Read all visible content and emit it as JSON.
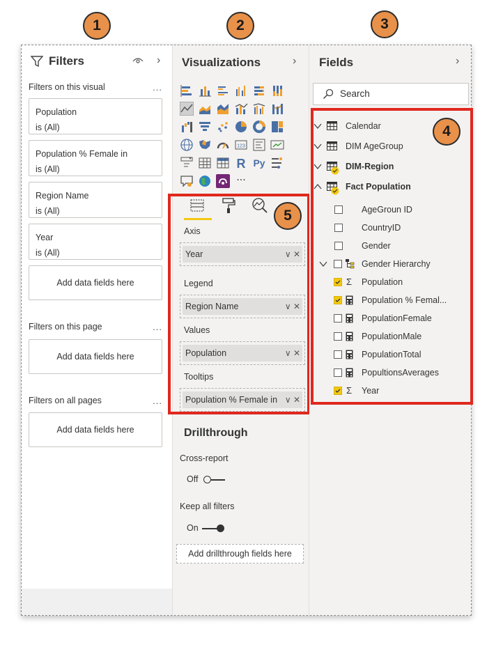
{
  "callouts": [
    "1",
    "2",
    "3",
    "4",
    "5"
  ],
  "filters": {
    "title": "Filters",
    "visual_section": "Filters on this visual",
    "cards": [
      {
        "name": "Population",
        "value": "is (All)"
      },
      {
        "name": "Population % Female in",
        "value": "is (All)"
      },
      {
        "name": "Region Name",
        "value": "is (All)"
      },
      {
        "name": "Year",
        "value": "is (All)"
      }
    ],
    "add_label": "Add data fields here",
    "page_section": "Filters on this page",
    "all_section": "Filters on all pages",
    "more": "...",
    "chevron": "›"
  },
  "viz": {
    "title": "Visualizations",
    "chevron": "›",
    "icon_rows": [
      [
        "stacked-bar-icon",
        "stacked-column-icon",
        "clustered-bar-icon",
        "clustered-column-icon",
        "100-bar-icon",
        "100-column-icon"
      ],
      [
        "line-chart-icon",
        "area-chart-icon",
        "stacked-area-icon",
        "line-column-icon",
        "line-clustered-icon",
        "ribbon-chart-icon"
      ],
      [
        "waterfall-icon",
        "funnel-icon",
        "scatter-icon",
        "pie-icon",
        "donut-icon",
        "treemap-icon"
      ],
      [
        "map-icon",
        "filled-map-icon",
        "gauge-icon",
        "card-icon",
        "multirow-card-icon",
        "kpi-icon"
      ],
      [
        "slicer-icon",
        "table-icon",
        "matrix-icon",
        "r-visual-icon",
        "python-visual-icon",
        "key-influencers-icon"
      ],
      [
        "qna-icon",
        "arcgis-icon",
        "power-apps-icon",
        "more-icon"
      ]
    ],
    "r_glyph": "R",
    "py_glyph": "Py",
    "more_glyph": "···",
    "wells": [
      {
        "label": "Axis",
        "field": "Year"
      },
      {
        "label": "Legend",
        "field": "Region Name"
      },
      {
        "label": "Values",
        "field": "Population"
      },
      {
        "label": "Tooltips",
        "field": "Population % Female in"
      }
    ],
    "pill_controls": "∨ ✕",
    "drillthrough": {
      "title": "Drillthrough",
      "cross_report": "Cross-report",
      "cross_state": "Off",
      "keep_filters": "Keep all filters",
      "keep_state": "On",
      "add_label": "Add drillthrough fields here"
    }
  },
  "fields": {
    "title": "Fields",
    "chevron": "›",
    "search_placeholder": "Search",
    "tables": [
      {
        "name": "Calendar",
        "bold": false,
        "expanded": false
      },
      {
        "name": "DIM AgeGroup",
        "bold": false,
        "expanded": false
      },
      {
        "name": "DIM-Region",
        "bold": true,
        "expanded": false
      },
      {
        "name": "Fact Population",
        "bold": true,
        "expanded": true
      }
    ],
    "columns": [
      {
        "name": "AgeGroun ID",
        "checked": false,
        "icon": "none"
      },
      {
        "name": "CountryID",
        "checked": false,
        "icon": "none"
      },
      {
        "name": "Gender",
        "checked": false,
        "icon": "none"
      },
      {
        "name": "Gender Hierarchy",
        "checked": false,
        "icon": "hierarchy"
      },
      {
        "name": "Population",
        "checked": true,
        "icon": "sigma"
      },
      {
        "name": "Population % Femal...",
        "checked": true,
        "icon": "calc"
      },
      {
        "name": "PopulationFemale",
        "checked": false,
        "icon": "calc"
      },
      {
        "name": "PopulationMale",
        "checked": false,
        "icon": "calc"
      },
      {
        "name": "PopulationTotal",
        "checked": false,
        "icon": "calc"
      },
      {
        "name": "PopultionsAverages",
        "checked": false,
        "icon": "calc"
      },
      {
        "name": "Year",
        "checked": true,
        "icon": "sigma"
      }
    ],
    "sigma_glyph": "Σ",
    "colors": {
      "check": "#f2c811",
      "highlight": "#e0281e",
      "badge": "#e8914a"
    }
  }
}
